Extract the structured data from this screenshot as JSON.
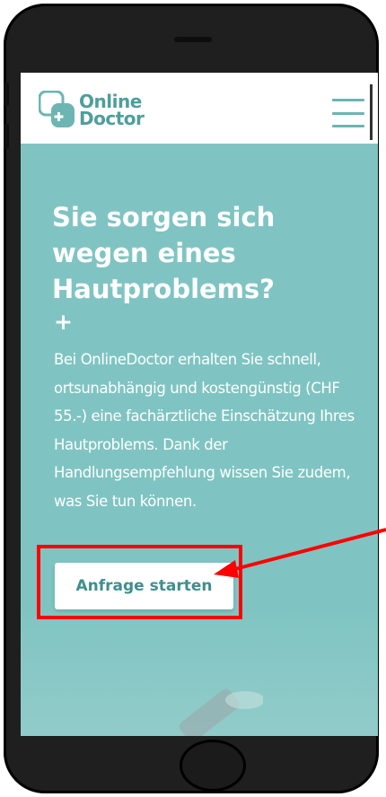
{
  "header": {
    "logo_line1": "Online",
    "logo_line2": "Doctor"
  },
  "hero": {
    "title": "Sie sorgen sich wegen eines Hautproblems?",
    "plus": "+",
    "description": "Bei OnlineDoctor erhalten Sie schnell, ortsunabhängig und kostengünstig (CHF 55.-) eine fachärztliche Einschätzung Ihres Hautproblems. Dank der Handlungsempfehlung wissen Sie zudem, was Sie tun können.",
    "cta_label": "Anfrage starten"
  },
  "icons": {
    "logo": "online-doctor-logo-icon",
    "menu": "hamburger-menu-icon",
    "annotation": "red-arrow-icon"
  },
  "colors": {
    "brand_teal": "#7fc4c2",
    "logo_teal": "#4e9e9c",
    "cta_text": "#3f8f8d",
    "annotation_red": "#ff0000"
  }
}
